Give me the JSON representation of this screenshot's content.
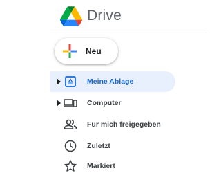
{
  "header": {
    "app_title": "Drive"
  },
  "new_button": {
    "label": "Neu"
  },
  "sidebar": {
    "items": [
      {
        "label": "Meine Ablage",
        "icon": "my-drive-icon",
        "active": true,
        "expandable": true
      },
      {
        "label": "Computer",
        "icon": "computer-icon",
        "active": false,
        "expandable": true
      },
      {
        "label": "Für mich freigegeben",
        "icon": "shared-with-me-icon",
        "active": false,
        "expandable": false
      },
      {
        "label": "Zuletzt",
        "icon": "recent-icon",
        "active": false,
        "expandable": false
      },
      {
        "label": "Markiert",
        "icon": "starred-icon",
        "active": false,
        "expandable": false
      }
    ]
  },
  "colors": {
    "active_bg": "#e8f0fe",
    "active_text": "#1967d2",
    "icon_gray": "#5f6368",
    "text": "#3c4043"
  }
}
